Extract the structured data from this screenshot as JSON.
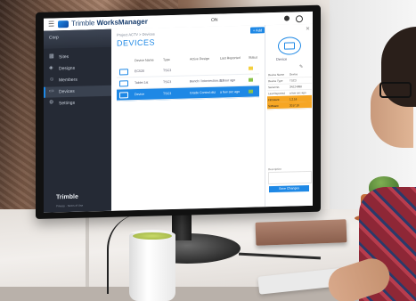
{
  "app": {
    "brand": "Trimble",
    "product": "WorksManager",
    "status_text": "ON",
    "add_button": "+ Add"
  },
  "sidebar": {
    "header": "Corp",
    "items": [
      {
        "label": "Sites",
        "icon": "map-icon"
      },
      {
        "label": "Designs",
        "icon": "layers-icon"
      },
      {
        "label": "Members",
        "icon": "users-icon"
      },
      {
        "label": "Devices",
        "icon": "device-icon",
        "active": true
      },
      {
        "label": "Settings",
        "icon": "gear-icon"
      }
    ],
    "footer_logo": "Trimble",
    "footer_sub": "Privacy · Terms of Use"
  },
  "main": {
    "breadcrumb": "Project ACTV > Devices",
    "title": "DEVICES",
    "columns": [
      "Device Name",
      "Type",
      "Active Design",
      "Last Reported",
      "Status"
    ],
    "rows": [
      {
        "name": "EC520",
        "type": "TSC3",
        "design": "",
        "reported": "",
        "status_color": "#f4d03f"
      },
      {
        "name": "Tablet 1st",
        "type": "TSC3",
        "design": "Bench / Intersection.dsz",
        "reported": "1 hour ago",
        "status_color": "#8bc34a"
      },
      {
        "name": "Device",
        "type": "TSC3",
        "design": "Grade Control.dsz",
        "reported": "a few sec ago",
        "status_color": "#8bc34a",
        "selected": true
      }
    ]
  },
  "panel": {
    "device_label": "Device",
    "rows": [
      {
        "k": "Device Name",
        "v": "Device"
      },
      {
        "k": "Device Type",
        "v": "TSC3"
      },
      {
        "k": "Serial No.",
        "v": "3N124888"
      },
      {
        "k": "Last Reported",
        "v": "a few sec ago"
      },
      {
        "k": "Firmware",
        "v": "1.2.16",
        "warn": true
      },
      {
        "k": "Software",
        "v": "2017.10",
        "warn": true
      }
    ],
    "notes_label": "Description",
    "button": "Save Changes"
  }
}
